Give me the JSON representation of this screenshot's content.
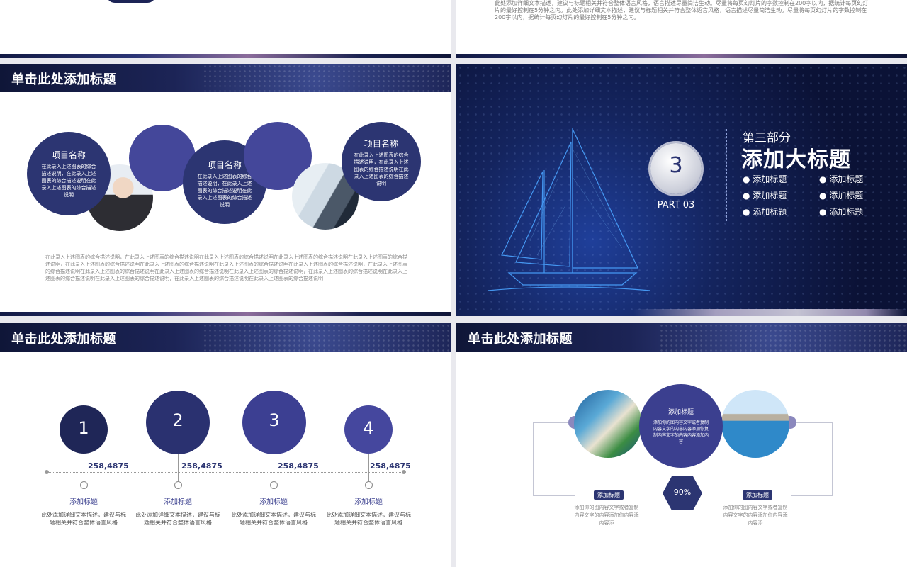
{
  "slides": {
    "top_right": {
      "paragraph": "此处添加详细文本描述，建议与标题相关并符合整体语言风格，语言描述尽量简洁生动。尽量将每页幻灯片的字数控制在200字以内，据统计每页幻灯片的最好控制在5分钟之内。此处添加详细文本描述，建议与标题相关并符合整体语言风格，语言描述尽量简洁生动。尽量将每页幻灯片的字数控制在200字以内，据统计每页幻灯片的最好控制在5分钟之内。"
    },
    "mid_left": {
      "header_title": "单击此处添加标题",
      "item1_title": "项目名称",
      "item1_text": "在此录入上述图表的综合描述说明，在此录入上述图表的综合描述说明在此录入上述图表的综合描述说明",
      "item2_title": "项目名称",
      "item2_text": "在此录入上述图表的综合描述说明，在此录入上述图表的综合描述说明在此录入上述图表的综合描述说明",
      "item3_title": "项目名称",
      "item3_text": "在此录入上述图表的综合描述说明，在此录入上述图表的综合描述说明在此录入上述图表的综合描述说明",
      "bottom_text": "在此录入上述图表的综合描述说明，在此录入上述图表的综合描述说明在此录入上述图表的综合描述说明在此录入上述图表的综合描述说明在此录入上述图表的综合描述说明，在此录入上述图表的综合描述说明在此录入上述图表的综合描述说明在此录入上述图表的综合描述说明在此录入上述图表的综合描述说明，在此录入上述图表的综合描述说明在此录入上述图表的综合描述说明在此录入上述图表的综合描述说明在此录入上述图表的综合描述说明，在此录入上述图表的综合描述说明在此录入上述图表的综合描述说明在此录入上述图表的综合描述说明，在此录入上述图表的综合描述说明在此录入上述图表的综合描述说明"
    },
    "mid_right": {
      "part_number": "3",
      "part_label": "PART 03",
      "section_small": "第三部分",
      "section_big": "添加大标题",
      "bullets": [
        "添加标题",
        "添加标题",
        "添加标题",
        "添加标题",
        "添加标题",
        "添加标题"
      ]
    },
    "bottom_left": {
      "header_title": "单击此处添加标题",
      "steps": [
        {
          "num": "1",
          "value": "258,4875",
          "label": "添加标题",
          "desc": "此处添加详细文本描述，建议与标题相关并符合整体语言风格"
        },
        {
          "num": "2",
          "value": "258,4875",
          "label": "添加标题",
          "desc": "此处添加详细文本描述，建议与标题相关并符合整体语言风格"
        },
        {
          "num": "3",
          "value": "258,4875",
          "label": "添加标题",
          "desc": "此处添加详细文本描述，建议与标题相关并符合整体语言风格"
        },
        {
          "num": "4",
          "value": "258,4875",
          "label": "添加标题",
          "desc": "此处添加详细文本描述，建议与标题相关并符合整体语言风格"
        }
      ]
    },
    "bottom_right": {
      "header_title": "单击此处添加标题",
      "center_title": "添加标题",
      "center_text": "添加你的图内容文字或者复制内容文字的内容内容添加你复制内容文字的内容内容添加内容",
      "percent": "90%",
      "left_tag": "添加标题",
      "left_text": "添加你的图内容文字或者复制内容文字的内容添加你内容添内容添",
      "right_tag": "添加标题",
      "right_text": "添加你的图内容文字或者复制内容文字的内容添加你内容添内容添"
    }
  },
  "colors": {
    "navy": "#2c3572",
    "purple": "#4a4f9e",
    "dark": "#1c2456"
  }
}
